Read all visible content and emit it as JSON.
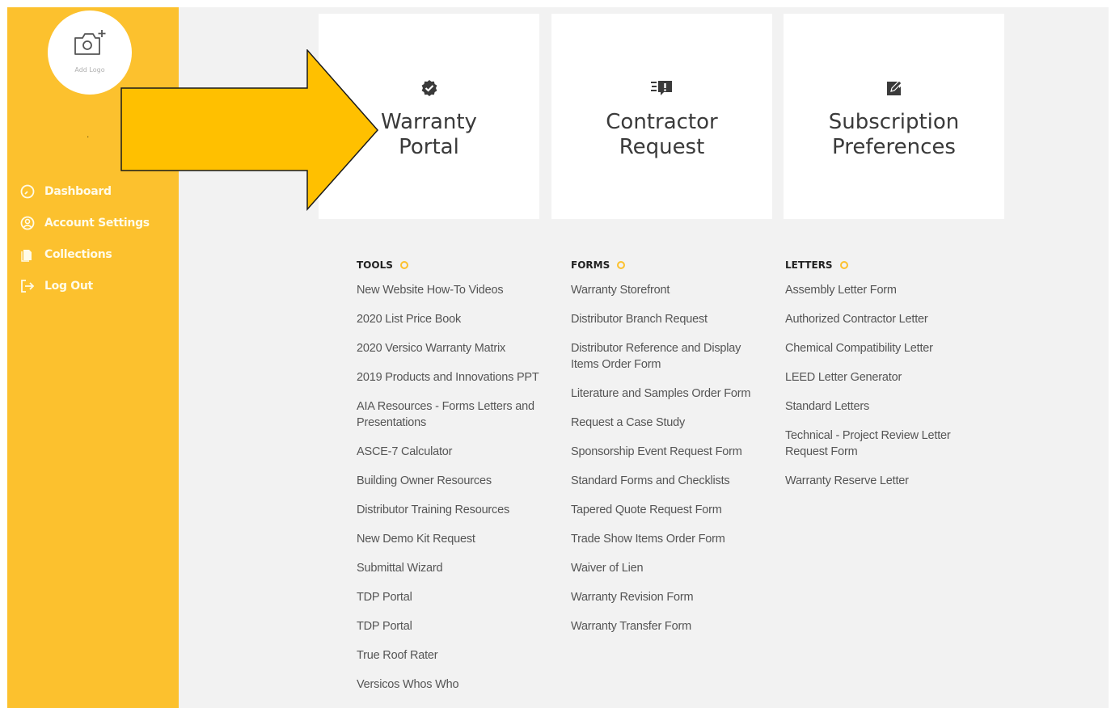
{
  "sidebar": {
    "logo_label": "Add Logo",
    "user_name": ".",
    "nav": [
      {
        "label": "Dashboard",
        "icon": "dashboard-gauge-icon"
      },
      {
        "label": "Account Settings",
        "icon": "account-user-icon"
      },
      {
        "label": "Collections",
        "icon": "collections-document-icon"
      },
      {
        "label": "Log Out",
        "icon": "logout-icon"
      }
    ]
  },
  "cards": [
    {
      "title": "Warranty\nPortal",
      "icon": "check-badge-icon"
    },
    {
      "title": "Contractor\nRequest",
      "icon": "request-chat-icon"
    },
    {
      "title": "Subscription\nPreferences",
      "icon": "edit-note-icon"
    }
  ],
  "columns": [
    {
      "heading": "TOOLS",
      "items": [
        "New Website How-To Videos",
        "2020 List Price Book",
        "2020 Versico Warranty Matrix",
        "2019 Products and Innovations PPT",
        "AIA Resources - Forms Letters and Presentations",
        "ASCE-7 Calculator",
        "Building Owner Resources",
        "Distributor Training Resources",
        "New Demo Kit Request",
        "Submittal Wizard",
        "TDP Portal",
        "TDP Portal",
        "True Roof Rater",
        "Versicos Whos Who"
      ]
    },
    {
      "heading": "FORMS",
      "items": [
        "Warranty Storefront",
        "Distributor Branch Request",
        "Distributor Reference and Display Items Order Form",
        "Literature and Samples Order Form",
        "Request a Case Study",
        "Sponsorship Event Request Form",
        "Standard Forms and Checklists",
        "Tapered Quote Request Form",
        "Trade Show Items Order Form",
        "Waiver of Lien",
        "Warranty Revision Form",
        "Warranty Transfer Form"
      ]
    },
    {
      "heading": "LETTERS",
      "items": [
        "Assembly Letter Form",
        "Authorized Contractor Letter",
        "Chemical Compatibility Letter",
        "LEED Letter Generator",
        "Standard Letters",
        "Technical - Project Review Letter Request Form",
        "Warranty Reserve Letter"
      ]
    }
  ],
  "colors": {
    "sidebar": "#fcc12e",
    "arrow_fill": "#ffc000",
    "background": "#f2f2f2"
  }
}
